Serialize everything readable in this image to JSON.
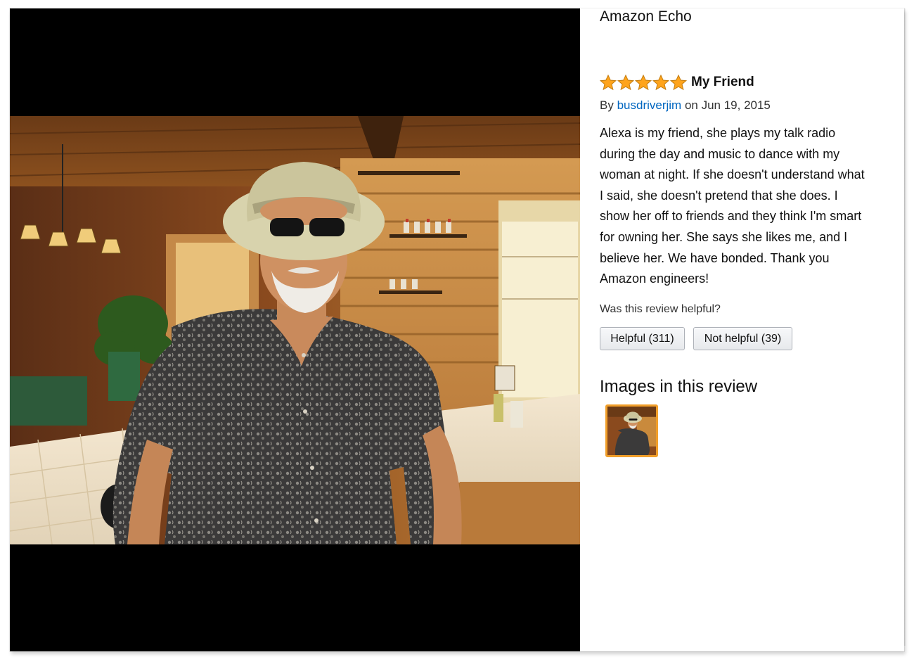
{
  "product": {
    "title": "Amazon Echo"
  },
  "review": {
    "rating": 5,
    "title": "My Friend",
    "by_prefix": "By",
    "author": "busdriverjim",
    "date_text": "on Jun 19, 2015",
    "body_lines": [
      "Alexa is my friend, she plays my talk radio",
      "during the day and music to dance with my",
      "woman at night. If she doesn't understand what",
      "I said, she doesn't pretend that she does. I",
      "show her off to friends and they think I'm smart",
      "for owning her. She says she likes me, and I",
      "believe her. We have bonded. Thank you",
      "Amazon engineers!"
    ]
  },
  "feedback": {
    "question": "Was this review helpful?",
    "helpful_label": "Helpful (311)",
    "not_helpful_label": "Not helpful (39)"
  },
  "images_section": {
    "heading": "Images in this review"
  },
  "icons": {
    "rating": "star-icon",
    "photo": "review-photo",
    "thumbnail": "review-image-thumbnail"
  },
  "colors": {
    "author_link": "#0066c0",
    "star_fill": "#ffa41c",
    "thumbnail_border": "#f19f2a",
    "viewer_background": "#000000"
  }
}
